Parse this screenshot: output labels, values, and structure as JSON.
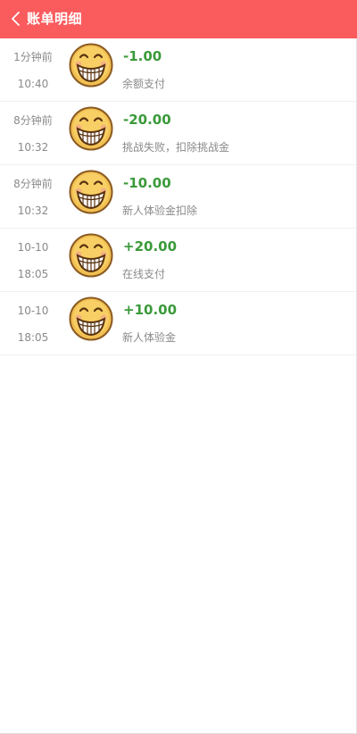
{
  "header": {
    "title": "账单明细",
    "background": "#fa5b5d"
  },
  "colors": {
    "amount": "#3a9a3a",
    "muted": "#8a8a8a"
  },
  "icons": {
    "back": "chevron-left-icon",
    "avatar": "grinning-emoji-avatar"
  },
  "records": [
    {
      "time_top": "1分钟前",
      "time_bottom": "10:40",
      "amount": "-1.00",
      "desc": "余额支付"
    },
    {
      "time_top": "8分钟前",
      "time_bottom": "10:32",
      "amount": "-20.00",
      "desc": "挑战失败，扣除挑战金"
    },
    {
      "time_top": "8分钟前",
      "time_bottom": "10:32",
      "amount": "-10.00",
      "desc": "新人体验金扣除"
    },
    {
      "time_top": "10-10",
      "time_bottom": "18:05",
      "amount": "+20.00",
      "desc": "在线支付"
    },
    {
      "time_top": "10-10",
      "time_bottom": "18:05",
      "amount": "+10.00",
      "desc": "新人体验金"
    }
  ]
}
